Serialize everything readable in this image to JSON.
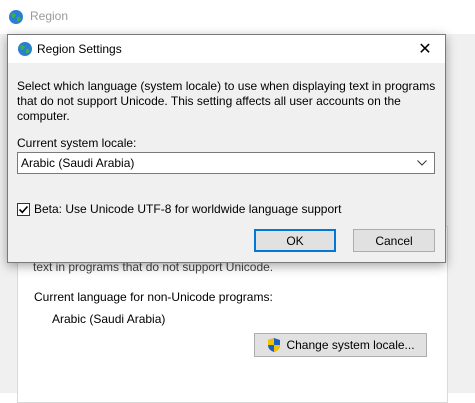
{
  "parent_window": {
    "title": "Region",
    "obscured_text": "text in programs that do not support Unicode.",
    "current_language_label": "Current language for non-Unicode programs:",
    "current_language_value": "Arabic (Saudi Arabia)",
    "change_locale_button": "Change system locale..."
  },
  "dialog": {
    "title": "Region Settings",
    "close_symbol": "✕",
    "description": "Select which language (system locale) to use when displaying text in programs that do not support Unicode. This setting affects all user accounts on the computer.",
    "locale_label": "Current system locale:",
    "locale_value": "Arabic (Saudi Arabia)",
    "beta_checkbox_label": "Beta: Use Unicode UTF-8 for worldwide language support",
    "beta_checked": true,
    "ok_label": "OK",
    "cancel_label": "Cancel"
  },
  "colors": {
    "focus_border": "#0078d7",
    "button_bg": "#e1e1e1",
    "dialog_bg": "#f0f0f0"
  }
}
